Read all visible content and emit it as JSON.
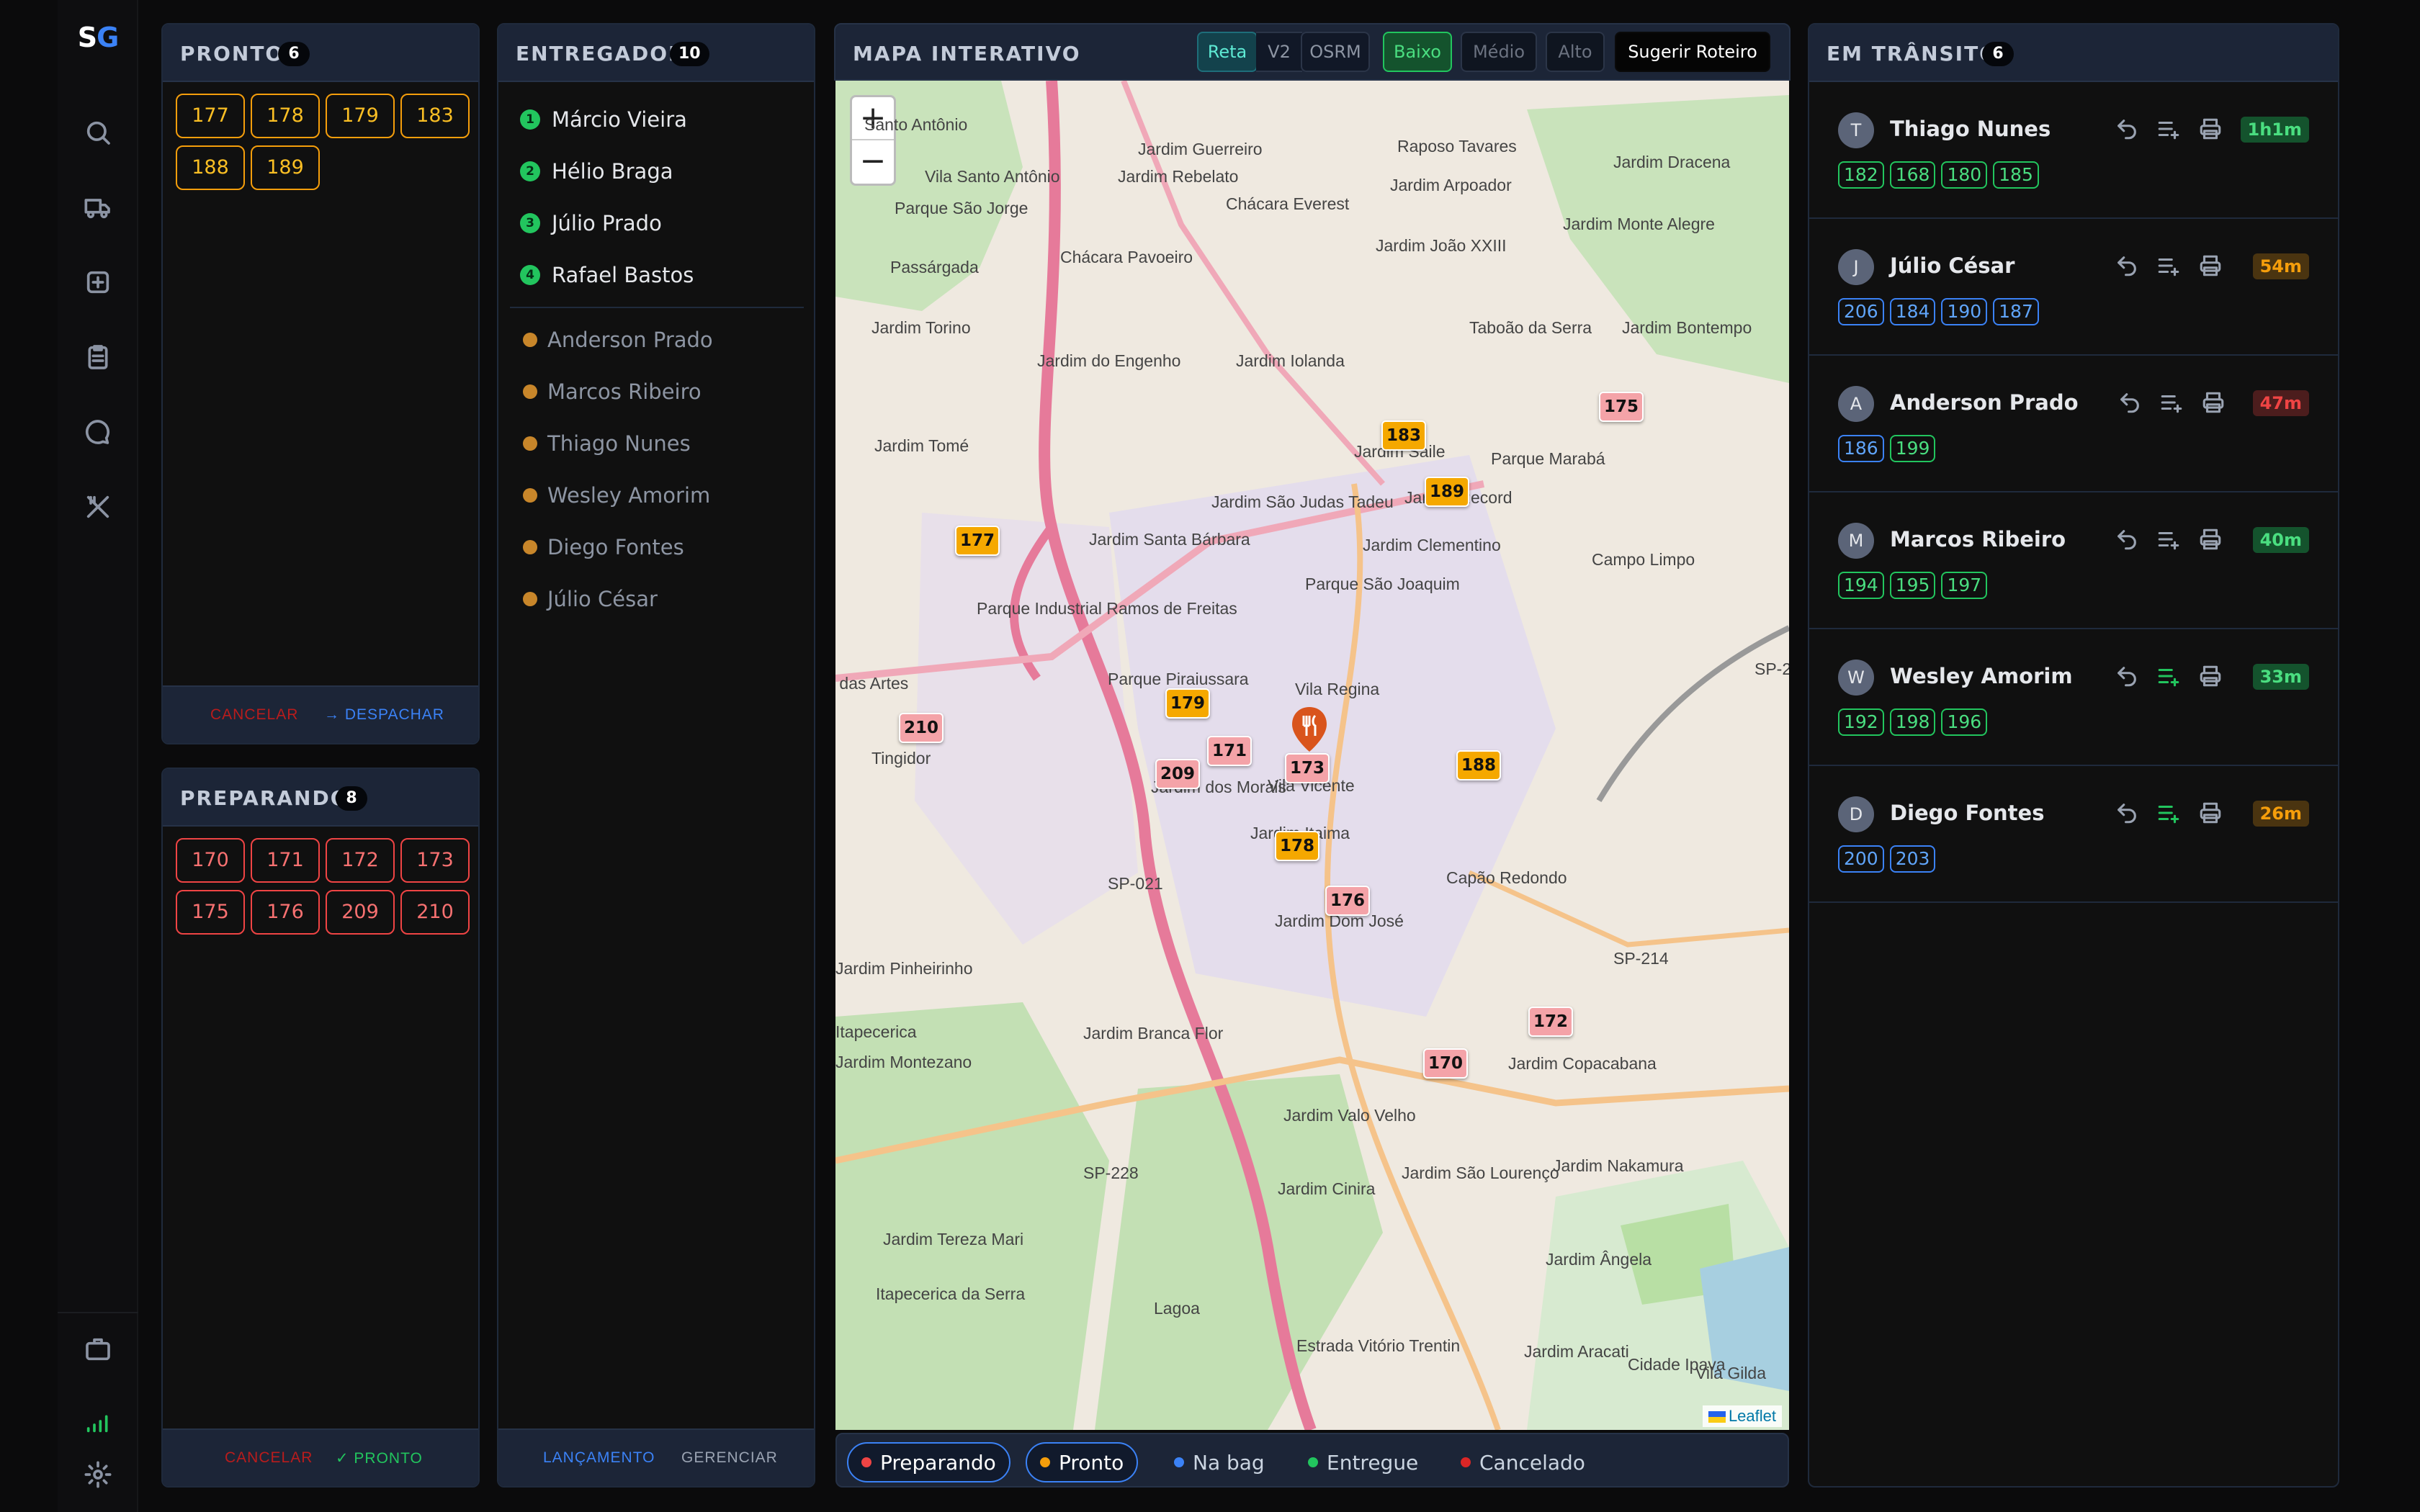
{
  "logo": {
    "s": "S",
    "g": "G"
  },
  "pronto": {
    "title": "PRONTO",
    "count": "6",
    "orders": [
      "177",
      "178",
      "179",
      "183",
      "188",
      "189"
    ],
    "cancel": "CANCELAR",
    "dispatch": "→ DESPACHAR"
  },
  "preparando": {
    "title": "PREPARANDO",
    "count": "8",
    "orders": [
      "170",
      "171",
      "172",
      "173",
      "175",
      "176",
      "209",
      "210"
    ],
    "cancel": "CANCELAR",
    "ready": "✓ PRONTO"
  },
  "entregador": {
    "title": "ENTREGADOR",
    "count": "10",
    "active": [
      {
        "n": "1",
        "name": "Márcio Vieira"
      },
      {
        "n": "2",
        "name": "Hélio Braga"
      },
      {
        "n": "3",
        "name": "Júlio Prado"
      },
      {
        "n": "4",
        "name": "Rafael Bastos"
      }
    ],
    "away": [
      "Anderson Prado",
      "Marcos Ribeiro",
      "Thiago Nunes",
      "Wesley Amorim",
      "Diego Fontes",
      "Júlio César"
    ],
    "launch": "LANÇAMENTO",
    "manage": "GERENCIAR"
  },
  "mapa": {
    "title": "MAPA INTERATIVO",
    "modes": [
      "Reta",
      "V2",
      "OSRM"
    ],
    "levels": [
      "Baixo",
      "Médio",
      "Alto"
    ],
    "suggest": "Sugerir Roteiro",
    "zoom_in": "+",
    "zoom_out": "−",
    "attribution": "Leaflet",
    "markers": [
      {
        "id": "175",
        "c": "p"
      },
      {
        "id": "183",
        "c": "o"
      },
      {
        "id": "189",
        "c": "o"
      },
      {
        "id": "177",
        "c": "o"
      },
      {
        "id": "210",
        "c": "p"
      },
      {
        "id": "179",
        "c": "o"
      },
      {
        "id": "171",
        "c": "p"
      },
      {
        "id": "209",
        "c": "p"
      },
      {
        "id": "173",
        "c": "p"
      },
      {
        "id": "188",
        "c": "o"
      },
      {
        "id": "178",
        "c": "o"
      },
      {
        "id": "176",
        "c": "p"
      },
      {
        "id": "172",
        "c": "p"
      },
      {
        "id": "170",
        "c": "p"
      }
    ],
    "places": [
      "Santo Antônio",
      "Jardim Guerreiro",
      "Raposo Tavares",
      "Jardim Dracena",
      "Vila Santo Antônio",
      "Jardim Rebelato",
      "Jardim Arpoador",
      "Parque São Jorge",
      "Chácara Everest",
      "Jardim Monte Alegre",
      "Chácara Pavoeiro",
      "Jardim João XXIII",
      "Passárgada",
      "Taboão da Serra",
      "Jardim Bontempo",
      "Jardim Torino",
      "Jardim do Engenho",
      "Jardim Iolanda",
      "Jardim Tomé",
      "Jardim Saile",
      "Parque Marabá",
      "Jardim São Judas Tadeu",
      "Jardim Record",
      "Jardim Santa Bárbara",
      "Jardim Clementino",
      "Campo Limpo",
      "Parque São Joaquim",
      "Parque Industrial Ramos de Freitas",
      "Parque Piraiussara",
      "Vila Regina",
      "Jardim das Artes",
      "Tingidor",
      "Jardim dos Morais",
      "Vila Vicente",
      "Jardim Itaima",
      "Capão Redondo",
      "Jardim Dom José",
      "Jardim Pinheirinho",
      "Itapecerica",
      "Jardim Montezano",
      "Jardim Branca Flor",
      "Jardim Copacabana",
      "Jardim Valo Velho",
      "Jardim Cinira",
      "Jardim São Lourenço",
      "Jardim Nakamura",
      "Jardim Tereza Mari",
      "Itapecerica da Serra",
      "Jardim Ângela",
      "Lagoa",
      "Estrada Vitório Trentin",
      "Jardim Aracati",
      "Vila Gilda",
      "Cidade Ipava",
      "SP-021",
      "SP-228",
      "SP-214",
      "SP-2"
    ]
  },
  "legend": [
    {
      "label": "Preparando",
      "color": "#ef4444",
      "active": true
    },
    {
      "label": "Pronto",
      "color": "#f59e0b",
      "active": true
    },
    {
      "label": "Na bag",
      "color": "#3b82f6",
      "active": false
    },
    {
      "label": "Entregue",
      "color": "#22c55e",
      "active": false
    },
    {
      "label": "Cancelado",
      "color": "#dc2626",
      "active": false
    }
  ],
  "transito": {
    "title": "EM TRÂNSITO",
    "count": "6",
    "rows": [
      {
        "initial": "T",
        "name": "Thiago Nunes",
        "time": "1h1m",
        "tone": "g",
        "chips": [
          [
            "182",
            "g"
          ],
          [
            "168",
            "g"
          ],
          [
            "180",
            "g"
          ],
          [
            "185",
            "g"
          ]
        ]
      },
      {
        "initial": "J",
        "name": "Júlio César",
        "time": "54m",
        "tone": "o",
        "chips": [
          [
            "206",
            "b"
          ],
          [
            "184",
            "b"
          ],
          [
            "190",
            "b"
          ],
          [
            "187",
            "b"
          ]
        ]
      },
      {
        "initial": "A",
        "name": "Anderson Prado",
        "time": "47m",
        "tone": "r",
        "chips": [
          [
            "186",
            "b"
          ],
          [
            "199",
            "g"
          ]
        ]
      },
      {
        "initial": "M",
        "name": "Marcos Ribeiro",
        "time": "40m",
        "tone": "g",
        "chips": [
          [
            "194",
            "g"
          ],
          [
            "195",
            "g"
          ],
          [
            "197",
            "g"
          ]
        ]
      },
      {
        "initial": "W",
        "name": "Wesley Amorim",
        "time": "33m",
        "tone": "g",
        "chips": [
          [
            "192",
            "g"
          ],
          [
            "198",
            "g"
          ],
          [
            "196",
            "g"
          ]
        ]
      },
      {
        "initial": "D",
        "name": "Diego Fontes",
        "time": "26m",
        "tone": "o",
        "chips": [
          [
            "200",
            "b"
          ],
          [
            "203",
            "b"
          ]
        ]
      }
    ]
  }
}
